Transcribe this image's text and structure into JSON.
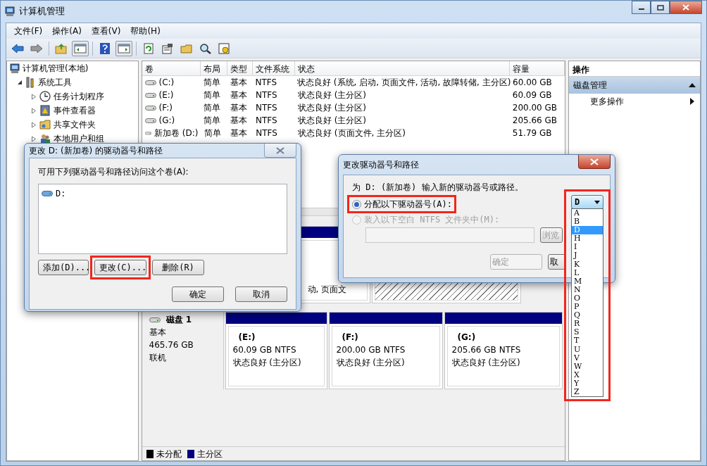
{
  "window": {
    "title": "计算机管理"
  },
  "menu": [
    "文件(F)",
    "操作(A)",
    "查看(V)",
    "帮助(H)"
  ],
  "tree": {
    "label": "计算机管理(本地)",
    "children": [
      {
        "label": "系统工具",
        "expanded": true,
        "children": [
          {
            "label": "任务计划程序",
            "expanded": false
          },
          {
            "label": "事件查看器",
            "expanded": false
          },
          {
            "label": "共享文件夹",
            "expanded": false
          },
          {
            "label": "本地用户和组",
            "expanded": false
          }
        ]
      }
    ]
  },
  "table": {
    "columns": [
      "卷",
      "布局",
      "类型",
      "文件系统",
      "状态",
      "容量"
    ],
    "rows": [
      [
        "(C:)",
        "简单",
        "基本",
        "NTFS",
        "状态良好 (系统, 启动, 页面文件, 活动, 故障转储, 主分区)",
        "60.00 GB"
      ],
      [
        "(E:)",
        "简单",
        "基本",
        "NTFS",
        "状态良好 (主分区)",
        "60.09 GB"
      ],
      [
        "(F:)",
        "简单",
        "基本",
        "NTFS",
        "状态良好 (主分区)",
        "200.00 GB"
      ],
      [
        "(G:)",
        "简单",
        "基本",
        "NTFS",
        "状态良好 (主分区)",
        "205.66 GB"
      ],
      [
        "新加卷 (D:)",
        "简单",
        "基本",
        "NTFS",
        "状态良好 (页面文件, 主分区)",
        "51.79 GB"
      ]
    ]
  },
  "disk_0": {
    "partitions": [
      {
        "kind": "primary",
        "text": "动, 页面文"
      },
      {
        "kind": "unallocated"
      }
    ]
  },
  "disk_1": {
    "name": "磁盘 1",
    "type": "基本",
    "size": "465.76 GB",
    "status": "联机",
    "partitions": [
      {
        "kind": "primary",
        "name": "(E:)",
        "size": "60.09 GB NTFS",
        "status": "状态良好 (主分区)"
      },
      {
        "kind": "primary",
        "name": "(F:)",
        "size": "200.00 GB NTFS",
        "status": "状态良好 (主分区)"
      },
      {
        "kind": "primary",
        "name": "(G:)",
        "size": "205.66 GB NTFS",
        "status": "状态良好 (主分区)"
      }
    ]
  },
  "legend": [
    {
      "label": "未分配",
      "color": "#000000"
    },
    {
      "label": "主分区",
      "color": "#000080"
    }
  ],
  "actions": {
    "header": "操作",
    "section": "磁盘管理",
    "items": [
      "更多操作"
    ]
  },
  "paths_dialog": {
    "title": "更改 D: (新加卷) 的驱动器号和路径",
    "label": "可用下列驱动器号和路径访问这个卷(A):",
    "paths": [
      "D:"
    ],
    "buttons": [
      {
        "label": "添加(D)...",
        "highlighted": false
      },
      {
        "label": "更改(C)...",
        "highlighted": true
      },
      {
        "label": "删除(R)",
        "highlighted": false
      }
    ],
    "footer": [
      "确定",
      "取消"
    ]
  },
  "change_dialog": {
    "title": "更改驱动器号和路径",
    "instruction": "为 D: (新加卷) 输入新的驱动器号或路径。",
    "options": [
      {
        "label": "分配以下驱动器号(A):",
        "selected": true,
        "disabled": false,
        "highlighted": true
      },
      {
        "label": "装入以下空白 NTFS 文件夹中(M):",
        "selected": false,
        "disabled": true,
        "highlighted": false
      }
    ],
    "browse": "浏览",
    "buttons": [
      {
        "label": "确定",
        "disabled": true
      },
      {
        "label": "取",
        "disabled": false
      }
    ],
    "dropdown": {
      "value": "D",
      "highlighted": true,
      "items": [
        {
          "label": "A",
          "selected": false
        },
        {
          "label": "B",
          "selected": false
        },
        {
          "label": "D",
          "selected": true
        },
        {
          "label": "H",
          "selected": false
        },
        {
          "label": "I",
          "selected": false
        },
        {
          "label": "J",
          "selected": false
        },
        {
          "label": "K",
          "selected": false
        },
        {
          "label": "L",
          "selected": false
        },
        {
          "label": "M",
          "selected": false
        },
        {
          "label": "N",
          "selected": false
        },
        {
          "label": "O",
          "selected": false
        },
        {
          "label": "P",
          "selected": false
        },
        {
          "label": "Q",
          "selected": false
        },
        {
          "label": "R",
          "selected": false
        },
        {
          "label": "S",
          "selected": false
        },
        {
          "label": "T",
          "selected": false
        },
        {
          "label": "U",
          "selected": false
        },
        {
          "label": "V",
          "selected": false
        },
        {
          "label": "W",
          "selected": false
        },
        {
          "label": "X",
          "selected": false
        },
        {
          "label": "Y",
          "selected": false
        },
        {
          "label": "Z",
          "selected": false
        }
      ]
    }
  }
}
